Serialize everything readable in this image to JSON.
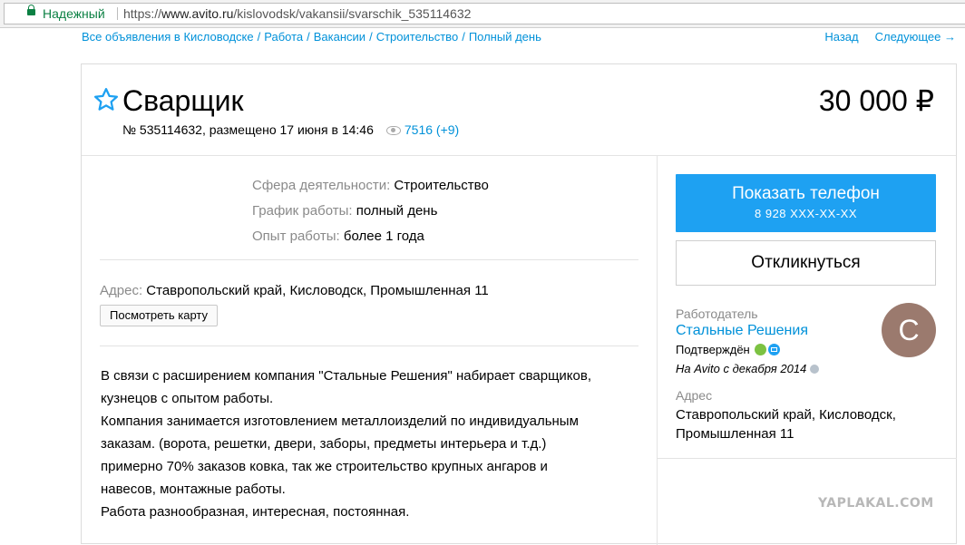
{
  "browser": {
    "secure_label": "Надежный",
    "url_scheme": "https://",
    "url_host": "www.avito.ru",
    "url_path": "/kislovodsk/vakansii/svarschik_535114632"
  },
  "breadcrumbs": [
    "Все объявления в Кисловодске",
    "Работа",
    "Вакансии",
    "Строительство",
    "Полный день"
  ],
  "breadcrumb_sep": "/",
  "nav": {
    "back": "Назад",
    "next": "Следующее →"
  },
  "listing": {
    "title": "Сварщик",
    "price": "30 000 ₽",
    "meta": "№ 535114632, размещено 17 июня в 14:46",
    "views": "7516 (+9)"
  },
  "params": [
    {
      "label": "Сфера деятельности:",
      "value": "Строительство"
    },
    {
      "label": "График работы:",
      "value": "полный день"
    },
    {
      "label": "Опыт работы:",
      "value": "более 1 года"
    }
  ],
  "address": {
    "label": "Адрес:",
    "value": "Ставропольский край, Кисловодск, Промышленная 11",
    "map_button": "Посмотреть карту"
  },
  "description": [
    "В связи с расширением компания \"Стальные Решения\" набирает сварщиков,",
    "кузнецов с опытом работы.",
    "Компания занимается изготовлением металлоизделий по индивидуальным",
    "заказам. (ворота, решетки, двери, заборы, предметы интерьера и т.д.)",
    "примерно 70% заказов ковка, так же строительство крупных ангаров и",
    "навесов, монтажные работы.",
    "Работа разнообразная, интересная, постоянная."
  ],
  "contact": {
    "show_phone": "Показать телефон",
    "phone_masked": "8 928 XXX-XX-XX",
    "reply": "Откликнуться"
  },
  "seller": {
    "label": "Работодатель",
    "name": "Стальные Решения",
    "confirmed": "Подтверждён",
    "since": "На Avito с декабря 2014",
    "avatar_letter": "С",
    "address_label": "Адрес",
    "address_line1": "Ставропольский край, Кисловодск,",
    "address_line2": "Промышленная 11"
  },
  "watermark": "YAPLAKAL.COM",
  "colors": {
    "link": "#0091d9",
    "primary_button": "#1ea1f2",
    "secure": "#0b8043",
    "avatar": "#9b7a6e"
  }
}
